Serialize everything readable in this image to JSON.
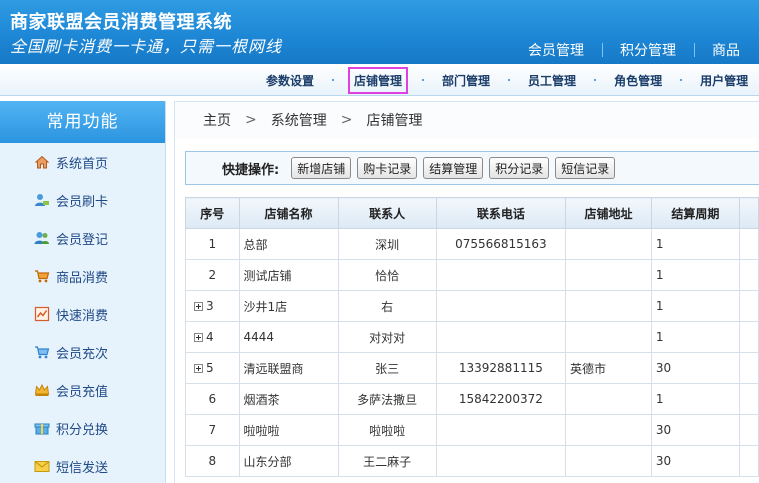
{
  "header": {
    "title": "商家联盟会员消费管理系统",
    "slogan": "全国刷卡消费一卡通，只需一根网线",
    "top_nav": [
      "会员管理",
      "积分管理",
      "商品"
    ]
  },
  "sub_nav": {
    "items": [
      "参数设置",
      "店铺管理",
      "部门管理",
      "员工管理",
      "角色管理",
      "用户管理"
    ],
    "active": "店铺管理"
  },
  "sidebar": {
    "title": "常用功能",
    "items": [
      {
        "label": "系统首页",
        "icon": "home-icon",
        "color": "#d06a2a"
      },
      {
        "label": "会员刷卡",
        "icon": "member-card-icon",
        "color": "#3a8fd6"
      },
      {
        "label": "会员登记",
        "icon": "member-register-icon",
        "color": "#2f7fc4"
      },
      {
        "label": "商品消费",
        "icon": "cart-icon",
        "color": "#e07d10"
      },
      {
        "label": "快速消费",
        "icon": "chart-icon",
        "color": "#d85b2a"
      },
      {
        "label": "会员充次",
        "icon": "recharge-count-icon",
        "color": "#2f86cf"
      },
      {
        "label": "会员充值",
        "icon": "crown-icon",
        "color": "#e0a020"
      },
      {
        "label": "积分兑换",
        "icon": "gift-icon",
        "color": "#3a9ad8"
      },
      {
        "label": "短信发送",
        "icon": "envelope-icon",
        "color": "#e0b020"
      }
    ]
  },
  "breadcrumb": [
    "主页",
    "系统管理",
    "店铺管理"
  ],
  "quick_actions": {
    "label": "快捷操作:",
    "buttons": [
      "新增店铺",
      "购卡记录",
      "结算管理",
      "积分记录",
      "短信记录"
    ]
  },
  "table": {
    "headers": [
      "序号",
      "店铺名称",
      "联系人",
      "联系电话",
      "店铺地址",
      "结算周期"
    ],
    "rows": [
      {
        "seq": "1",
        "expandable": false,
        "name": "总部",
        "contact": "深圳",
        "phone": "075566815163",
        "address": "",
        "cycle": "1"
      },
      {
        "seq": "2",
        "expandable": false,
        "name": "测试店铺",
        "contact": "恰恰",
        "phone": "",
        "address": "",
        "cycle": "1"
      },
      {
        "seq": "3",
        "expandable": true,
        "name": "沙井1店",
        "contact": "右",
        "phone": "",
        "address": "",
        "cycle": "1"
      },
      {
        "seq": "4",
        "expandable": true,
        "name": "4444",
        "contact": "对对对",
        "phone": "",
        "address": "",
        "cycle": "1"
      },
      {
        "seq": "5",
        "expandable": true,
        "name": "清远联盟商",
        "contact": "张三",
        "phone": "13392881115",
        "address": "英德市",
        "cycle": "30"
      },
      {
        "seq": "6",
        "expandable": false,
        "name": "烟酒茶",
        "contact": "多萨法撒旦",
        "phone": "15842200372",
        "address": "",
        "cycle": "1"
      },
      {
        "seq": "7",
        "expandable": false,
        "name": "啦啦啦",
        "contact": "啦啦啦",
        "phone": "",
        "address": "",
        "cycle": "30"
      },
      {
        "seq": "8",
        "expandable": false,
        "name": "山东分部",
        "contact": "王二麻子",
        "phone": "",
        "address": "",
        "cycle": "30"
      }
    ]
  }
}
